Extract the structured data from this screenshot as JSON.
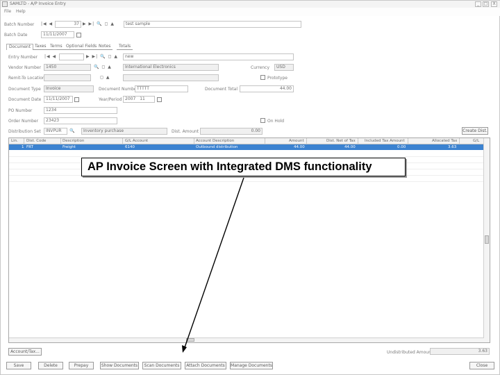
{
  "window": {
    "title": "SAMLTD - A/P Invoice Entry",
    "minimize": "_",
    "maximize": "□",
    "close": "X"
  },
  "menu": {
    "file": "File",
    "help": "Help"
  },
  "batch": {
    "number_label": "Batch Number",
    "number_value": "37",
    "description": "test sample",
    "date_label": "Batch Date",
    "date_value": "11/11/2007"
  },
  "tabs": [
    "Document",
    "Taxes",
    "Terms",
    "Optional Fields",
    "Notes",
    "Totals"
  ],
  "form": {
    "entry_number_label": "Entry Number",
    "entry_description": "new",
    "vendor_number_label": "Vendor Number",
    "vendor_number": "1450",
    "vendor_name": "International Electronics",
    "currency_label": "Currency",
    "currency": "USD",
    "remit_label": "Remit-To Location",
    "prototype_label": "Prototype",
    "doc_type_label": "Document Type",
    "doc_type": "Invoice",
    "doc_number_label": "Document Number",
    "doc_number": "TTTTT",
    "doc_total_label": "Document Total",
    "doc_total": "44.00",
    "doc_date_label": "Document Date",
    "doc_date": "11/11/2007",
    "year_period_label": "Year/Period",
    "year": "2007",
    "period": "11",
    "po_number_label": "PO Number",
    "po_number": "1234",
    "order_number_label": "Order Number",
    "order_number": "23423",
    "on_hold_label": "On Hold",
    "dist_set_label": "Distribution Set",
    "dist_set_code": "INVPUR",
    "dist_set_desc": "Inventory purchase",
    "dist_amount_label": "Dist. Amount",
    "dist_amount": "0.00",
    "create_dist_button": "Create Dist."
  },
  "grid": {
    "headers": [
      "Lin.",
      "Dist. Code",
      "Description",
      "G/L Account",
      "Account Description",
      "Amount",
      "Dist. Net of Tax",
      "Included Tax Amount",
      "Allocated Tax",
      "G/L"
    ],
    "rows": [
      [
        "1",
        "FRT",
        "Freight",
        "6140",
        "Outbound distribution",
        "44.00",
        "44.00",
        "0.00",
        "3.63",
        ""
      ]
    ]
  },
  "footer": {
    "account_tax_button": "Account/Tax...",
    "undistributed_label": "Undistributed Amount",
    "undistributed_value": "3.63"
  },
  "buttons": {
    "save": "Save",
    "delete": "Delete",
    "prepay": "Prepay",
    "show_documents": "Show Documents",
    "scan_documents": "Scan Documents",
    "attach_documents": "Attach Documents",
    "manage_documents": "Manage Documents",
    "close": "Close"
  },
  "annotation": {
    "text": "AP Invoice Screen with Integrated DMS functionality"
  }
}
